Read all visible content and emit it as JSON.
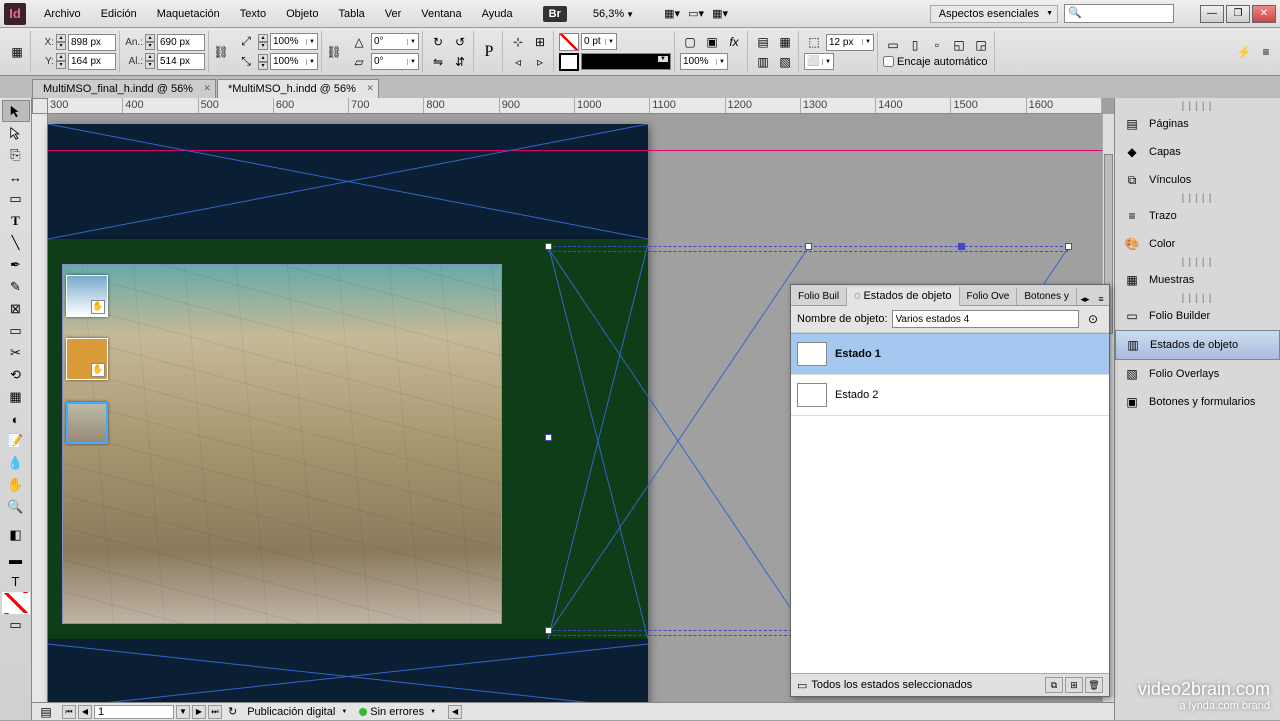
{
  "app": {
    "id_label": "Id",
    "br_label": "Br"
  },
  "menu": [
    "Archivo",
    "Edición",
    "Maquetación",
    "Texto",
    "Objeto",
    "Tabla",
    "Ver",
    "Ventana",
    "Ayuda"
  ],
  "zoom": "56,3%",
  "workspace_select": "Aspectos esenciales",
  "control": {
    "x": "898 px",
    "y": "164 px",
    "w": "690 px",
    "h": "514 px",
    "scale_x": "100%",
    "scale_y": "100%",
    "rotate": "0°",
    "shear": "0°",
    "stroke_pt": "0 pt",
    "stroke_weight": "12 px",
    "opacity": "100%",
    "autofit_label": "Encaje automático"
  },
  "tabs": [
    {
      "label": "MultiMSO_final_h.indd @ 56%",
      "active": false
    },
    {
      "label": "*MultiMSO_h.indd @ 56%",
      "active": true
    }
  ],
  "ruler_marks": [
    "300",
    "400",
    "500",
    "600",
    "700",
    "800",
    "900",
    "1000",
    "1100",
    "1200",
    "1300",
    "1400",
    "1500",
    "1600"
  ],
  "states_panel": {
    "tabs": [
      "Folio Buil",
      "Estados de objeto",
      "Folio Ove",
      "Botones y"
    ],
    "active_tab": 1,
    "name_label": "Nombre de objeto:",
    "name_value": "Varios estados 4",
    "states": [
      {
        "label": "Estado 1",
        "selected": true
      },
      {
        "label": "Estado 2",
        "selected": false
      }
    ],
    "footer_text": "Todos los estados seleccionados"
  },
  "dock": {
    "items": [
      {
        "label": "Páginas",
        "icon": "pages-icon"
      },
      {
        "label": "Capas",
        "icon": "layers-icon"
      },
      {
        "label": "Vínculos",
        "icon": "links-icon"
      }
    ],
    "items2": [
      {
        "label": "Trazo",
        "icon": "stroke-icon"
      },
      {
        "label": "Color",
        "icon": "color-icon"
      }
    ],
    "items3": [
      {
        "label": "Muestras",
        "icon": "swatches-icon"
      }
    ],
    "items4": [
      {
        "label": "Folio Builder",
        "icon": "folio-builder-icon"
      },
      {
        "label": "Estados de objeto",
        "icon": "object-states-icon",
        "active": true
      },
      {
        "label": "Folio Overlays",
        "icon": "folio-overlays-icon"
      },
      {
        "label": "Botones y formularios",
        "icon": "buttons-forms-icon"
      }
    ]
  },
  "status": {
    "page": "1",
    "intent": "Publicación digital",
    "errors": "Sin errores"
  },
  "watermark": {
    "line1": "video2brain.com",
    "line2": "a lynda.com brand"
  }
}
